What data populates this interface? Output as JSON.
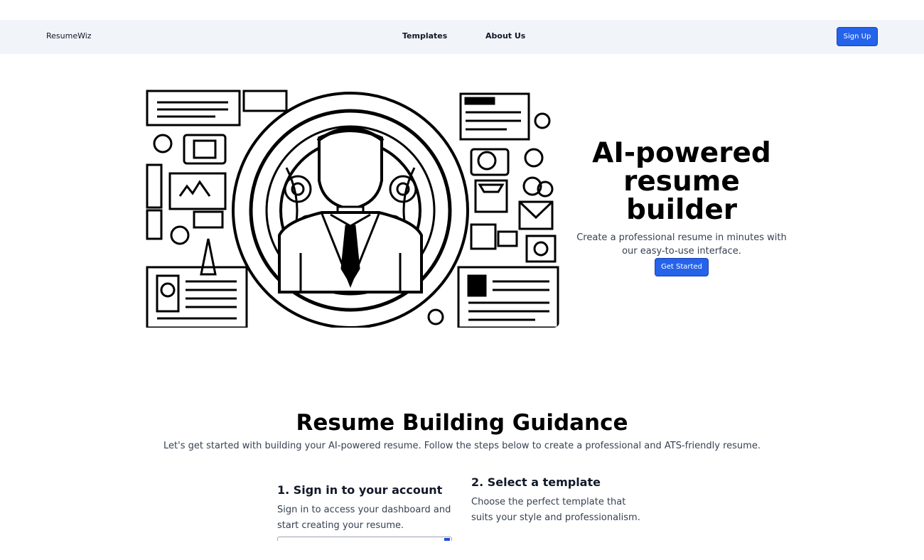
{
  "nav": {
    "brand": "ResumeWiz",
    "links": [
      "Templates",
      "About Us"
    ],
    "signup_label": "Sign Up"
  },
  "hero": {
    "title": "AI-powered resume builder",
    "subtitle": "Create a professional resume in minutes with our easy-to-use interface.",
    "cta_label": "Get Started",
    "illustration": "ai-resume-illustration"
  },
  "guidance": {
    "title": "Resume Building Guidance",
    "intro": "Let's get started with building your AI-powered resume. Follow the steps below to create a professional and ATS-friendly resume.",
    "steps": [
      {
        "title": "1. Sign in to your account",
        "text": "Sign in to access your dashboard and start creating your resume."
      },
      {
        "title": "2. Select a template",
        "text": "Choose the perfect template that suits your style and professionalism."
      }
    ]
  },
  "colors": {
    "accent": "#2563eb",
    "nav_bg": "#f1f5f9"
  }
}
